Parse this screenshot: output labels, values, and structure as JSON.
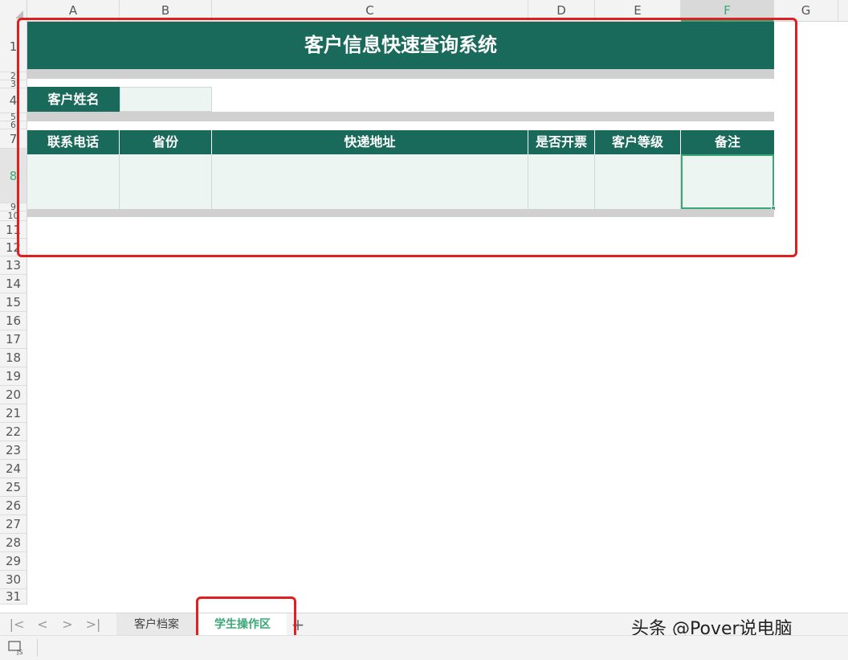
{
  "columns": [
    "A",
    "B",
    "C",
    "D",
    "E",
    "F",
    "G"
  ],
  "active_column": "F",
  "rows": [
    "1",
    "2",
    "3",
    "4",
    "5",
    "6",
    "7",
    "8",
    "9",
    "10",
    "11",
    "12",
    "13",
    "14",
    "15",
    "16",
    "17",
    "18",
    "19",
    "20",
    "21",
    "22",
    "23",
    "24",
    "25",
    "26",
    "27",
    "28",
    "29",
    "30",
    "31"
  ],
  "active_row": "8",
  "sheet": {
    "title": "客户信息快速查询系统",
    "name_label": "客户姓名",
    "name_value": "",
    "table_headers": [
      "联系电话",
      "省份",
      "快递地址",
      "是否开票",
      "客户等级",
      "备注"
    ]
  },
  "tabs": {
    "nav": [
      "|<",
      "<",
      ">",
      ">|"
    ],
    "sheets": [
      "客户档案",
      "学生操作区"
    ],
    "active": "学生操作区",
    "add": "+"
  },
  "watermark": "头条 @Pover说电脑",
  "colors": {
    "header_teal": "#1a6a5c",
    "active_green": "#3aa876",
    "highlight_red": "#e02020",
    "input_fill": "#ecf5f2",
    "separator_gray": "#d0d0d0"
  }
}
